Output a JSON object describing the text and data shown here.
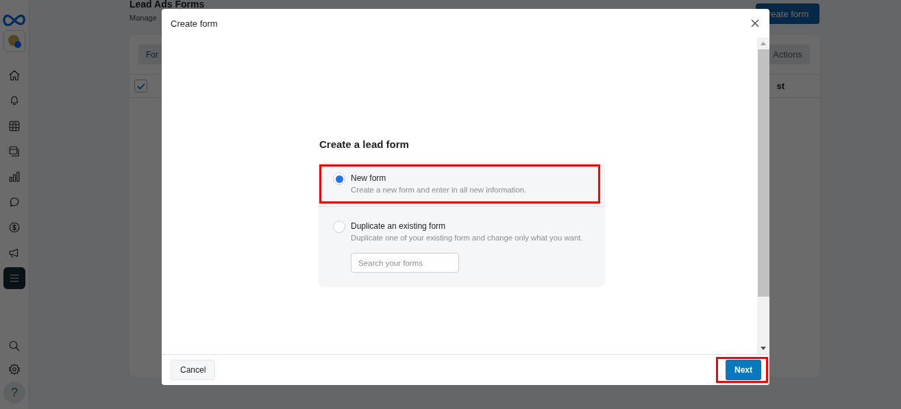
{
  "rail": {
    "nav": [
      {
        "kind": "home",
        "selected": false
      },
      {
        "kind": "bell",
        "selected": false
      },
      {
        "kind": "table",
        "selected": false
      },
      {
        "kind": "pages",
        "selected": false
      },
      {
        "kind": "chart",
        "selected": false
      },
      {
        "kind": "chat",
        "selected": false
      },
      {
        "kind": "dollar",
        "selected": false
      },
      {
        "kind": "megaphone",
        "selected": false
      },
      {
        "kind": "menu",
        "selected": true
      }
    ],
    "bottom": [
      {
        "kind": "search"
      },
      {
        "kind": "settings"
      },
      {
        "kind": "help",
        "text": "?"
      }
    ]
  },
  "page": {
    "title": "Lead Ads Forms",
    "subtitle": "Manage",
    "create_button": "reate form",
    "tab": "For",
    "actions_button": "Actions",
    "header_checked": true,
    "column_last": "st"
  },
  "dialog": {
    "title": "Create form",
    "heading": "Create a lead form",
    "options": [
      {
        "label": "New form",
        "description": "Create a new form and enter in all new information.",
        "selected": true,
        "annotated": true
      },
      {
        "label": "Duplicate an existing form",
        "description": "Duplicate one of your existing form and change only what you want.",
        "selected": false,
        "annotated": false
      }
    ],
    "search": {
      "placeholder": "Search your forms"
    },
    "cancel_button": "Cancel",
    "next_button": {
      "label": "Next",
      "annotated": true
    }
  }
}
